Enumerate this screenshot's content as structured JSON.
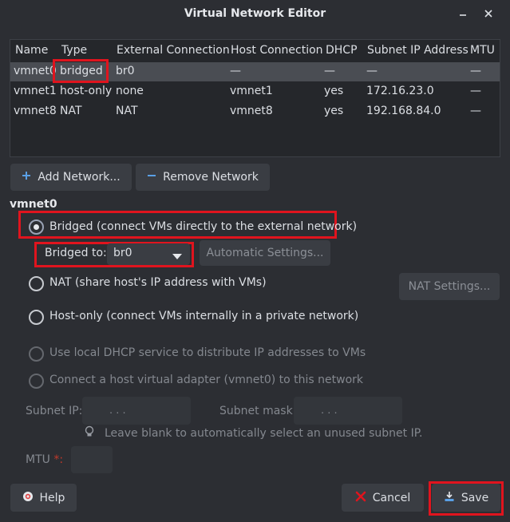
{
  "window": {
    "title": "Virtual Network Editor",
    "minimize_glyph": "⌄",
    "close_glyph": "✕"
  },
  "table": {
    "columns": [
      "Name",
      "Type",
      "External Connection",
      "Host Connection",
      "DHCP",
      "Subnet IP Address",
      "MTU"
    ],
    "rows": [
      {
        "name": "vmnet0",
        "type": "bridged",
        "external": "br0",
        "host": "—",
        "dhcp": "—",
        "subnet": "—",
        "mtu": "—"
      },
      {
        "name": "vmnet1",
        "type": "host-only",
        "external": "none",
        "host": "vmnet1",
        "dhcp": "yes",
        "subnet": "172.16.23.0",
        "mtu": "—"
      },
      {
        "name": "vmnet8",
        "type": "NAT",
        "external": "NAT",
        "host": "vmnet8",
        "dhcp": "yes",
        "subnet": "192.168.84.0",
        "mtu": "—"
      }
    ]
  },
  "actions": {
    "add_label": "Add Network...",
    "remove_label": "Remove Network"
  },
  "details": {
    "section_title": "vmnet0",
    "bridged_label": "Bridged (connect VMs directly to the external network)",
    "bridged_to_label": "Bridged to:",
    "bridged_to_value": "br0",
    "auto_settings_label": "Automatic Settings...",
    "nat_label": "NAT (share host's IP address with VMs)",
    "nat_settings_label": "NAT Settings...",
    "hostonly_label": "Host-only (connect VMs internally in a private network)",
    "dhcp_label": "Use local DHCP service to distribute IP addresses to VMs",
    "adapter_label": "Connect a host virtual adapter (vmnet0) to this network",
    "subnet_ip_label": "Subnet IP:",
    "subnet_ip_value": ".     .     .",
    "subnet_mask_label": "Subnet mask:",
    "subnet_mask_value": ".     .     .",
    "hint": "Leave blank to automatically select an unused subnet IP.",
    "mtu_label": "MTU",
    "mtu_required": "*:",
    "selected_mode": "bridged"
  },
  "footer": {
    "help_label": "Help",
    "cancel_label": "Cancel",
    "save_label": "Save"
  },
  "colors": {
    "background": "#2c2e33",
    "selection": "#4a4d53",
    "highlight_box": "#e0141e",
    "add_icon": "#5aa0e6",
    "cancel_icon": "#e0141e"
  }
}
